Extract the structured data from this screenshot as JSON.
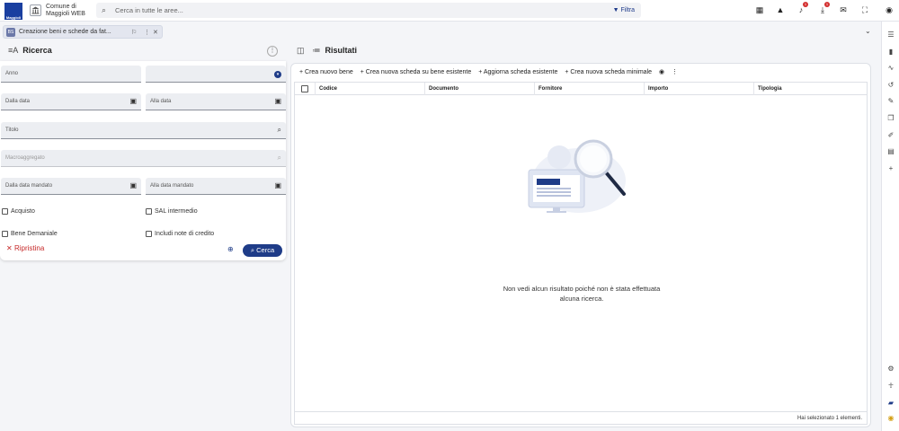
{
  "app": {
    "logo_text": "Maggioli",
    "org_line1": "Comune di",
    "org_line2": "Maggioli WEB",
    "search_placeholder": "Cerca in tutte le aree...",
    "filter_label": "Filtra",
    "notifications_count": "1",
    "downloads_count": "1"
  },
  "tab": {
    "icon_text": "BS",
    "label": "Creazione beni e schede da fat..."
  },
  "left": {
    "title": "Ricerca",
    "fields": {
      "anno": "Anno",
      "dalla_data": "Dalla data",
      "alla_data": "Alla data",
      "titolo": "Titolo",
      "macroaggregato": "Macroaggregato",
      "dalla_data_mandato": "Dalla data mandato",
      "alla_data_mandato": "Alla data mandato"
    },
    "checkboxes": {
      "acquisto": "Acquisto",
      "sal_intermedio": "SAL intermedio",
      "bene_demaniale": "Bene Demaniale",
      "includi_note": "Includi note di credito"
    },
    "reset_label": "Ripristina",
    "search_label": "Cerca"
  },
  "right": {
    "title": "Risultati",
    "actions": [
      "+ Crea nuovo bene",
      "+ Crea nuova scheda su bene esistente",
      "+ Aggiorna scheda esistente",
      "+ Crea nuova scheda minimale"
    ],
    "columns": [
      "Codice",
      "Documento",
      "Fornitore",
      "Importo",
      "Tipologia"
    ],
    "empty_line1": "Non vedi alcun risultato poiché non è stata effettuata",
    "empty_line2": "alcuna ricerca.",
    "footer_text": "Hai selezionato 1 elementi."
  },
  "colors": {
    "primary": "#1f3c88",
    "danger": "#c62828",
    "badge": "#d32f2f"
  }
}
